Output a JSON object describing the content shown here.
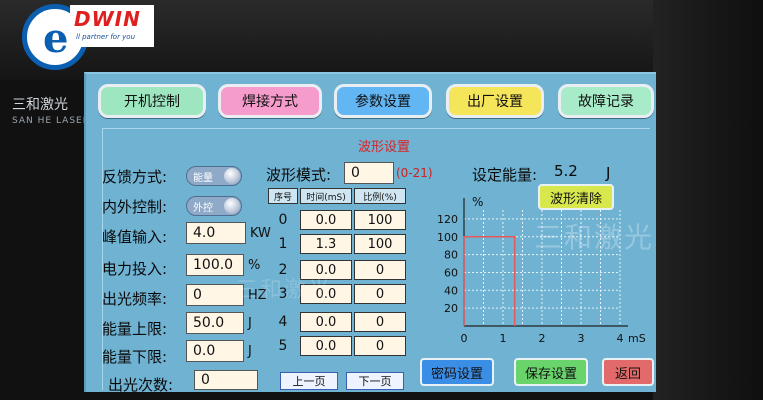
{
  "branding": {
    "dwin_word": "DWIN",
    "dwin_tagline": "ll partner for you",
    "maker_cn": "三和激光",
    "maker_en": "SAN HE LASER"
  },
  "tabs": [
    {
      "label": "开机控制"
    },
    {
      "label": "焊接方式"
    },
    {
      "label": "参数设置"
    },
    {
      "label": "出厂设置"
    },
    {
      "label": "故障记录"
    }
  ],
  "section_title": "波形设置",
  "left": {
    "feedback_label": "反馈方式:",
    "feedback_value": "能量",
    "control_label": "内外控制:",
    "control_value": "外控",
    "peak_label": "峰值输入:",
    "peak_value": "4.0",
    "peak_unit": "KW",
    "power_label": "电力投入:",
    "power_value": "100.0",
    "power_unit": "%",
    "freq_label": "出光频率:",
    "freq_value": "0",
    "freq_unit": "HZ",
    "upper_label": "能量上限:",
    "upper_value": "50.0",
    "upper_unit": "J",
    "lower_label": "能量下限:",
    "lower_value": "0.0",
    "lower_unit": "J",
    "count_label": "出光次数:",
    "count_value": "0"
  },
  "wave": {
    "mode_label": "波形模式:",
    "mode_value": "0",
    "mode_range": "(0-21)",
    "energy_label": "设定能量:",
    "energy_value": "5.2",
    "energy_unit": "J"
  },
  "table": {
    "headers": [
      "序号",
      "时间(mS)",
      "比例(%)"
    ],
    "rows": [
      {
        "idx": "0",
        "time": "0.0",
        "ratio": "100"
      },
      {
        "idx": "1",
        "time": "1.3",
        "ratio": "100"
      },
      {
        "idx": "2",
        "time": "0.0",
        "ratio": "0"
      },
      {
        "idx": "3",
        "time": "0.0",
        "ratio": "0"
      },
      {
        "idx": "4",
        "time": "0.0",
        "ratio": "0"
      },
      {
        "idx": "5",
        "time": "0.0",
        "ratio": "0"
      }
    ]
  },
  "buttons": {
    "clear": "波形清除",
    "prev": "上一页",
    "next": "下一页",
    "password": "密码设置",
    "save": "保存设置",
    "back": "返回"
  },
  "chart_data": {
    "type": "line",
    "ylabel": "%",
    "xlabel": "mS",
    "x_ticks": [
      0,
      1,
      2,
      3,
      4
    ],
    "y_ticks": [
      20,
      40,
      60,
      80,
      100,
      120
    ],
    "xlim": [
      0,
      4
    ],
    "ylim": [
      0,
      130
    ],
    "series": [
      {
        "x": [
          0,
          0,
          1.3,
          1.3
        ],
        "y": [
          0,
          100,
          100,
          0
        ]
      }
    ],
    "grid": true
  },
  "colors": {
    "screen_bg": "#6fb2d2",
    "title_red": "#dd2222",
    "wave_red": "#e85a5a"
  }
}
